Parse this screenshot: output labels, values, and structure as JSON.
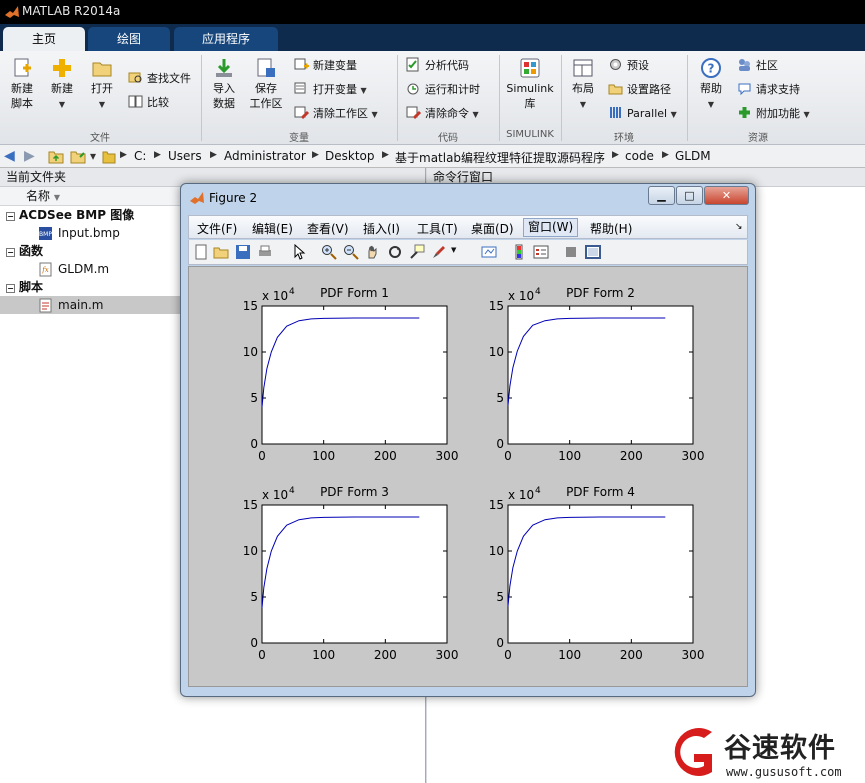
{
  "window": {
    "title": "MATLAB R2014a"
  },
  "tabs": [
    "主页",
    "绘图",
    "应用程序"
  ],
  "ribbon": {
    "file": {
      "new_script": "新建\n脚本",
      "new": "新建",
      "open": "打开",
      "find_files": "查找文件",
      "compare": "比较",
      "group": "文件"
    },
    "variable": {
      "import": "导入\n数据",
      "save_ws": "保存\n工作区",
      "new_var": "新建变量",
      "open_var": "打开变量",
      "clear_ws": "清除工作区",
      "group": "变量"
    },
    "code": {
      "analyze": "分析代码",
      "run_time": "运行和计时",
      "clear_cmd": "清除命令",
      "group": "代码"
    },
    "simulink": {
      "lib": "Simulink\n库",
      "group": "SIMULINK"
    },
    "env": {
      "layout": "布局",
      "prefs": "预设",
      "set_path": "设置路径",
      "parallel": "Parallel",
      "group": "环境"
    },
    "resources": {
      "help": "帮助",
      "community": "社区",
      "support": "请求支持",
      "addons": "附加功能",
      "group": "资源"
    }
  },
  "address": {
    "crumbs": [
      "C:",
      "Users",
      "Administrator",
      "Desktop",
      "基于matlab编程纹理特征提取源码程序",
      "code",
      "GLDM"
    ]
  },
  "left_panel": {
    "title": "当前文件夹",
    "column": "名称",
    "sections": [
      {
        "header": "ACDSee BMP 图像",
        "items": [
          "Input.bmp"
        ]
      },
      {
        "header": "函数",
        "items": [
          "GLDM.m"
        ]
      },
      {
        "header": "脚本",
        "items": [
          "main.m"
        ]
      }
    ]
  },
  "right_panel": {
    "title": "命令行窗口"
  },
  "figure": {
    "title": "Figure 2",
    "menus": [
      "文件(F)",
      "编辑(E)",
      "查看(V)",
      "插入(I)",
      "工具(T)",
      "桌面(D)",
      "窗口(W)",
      "帮助(H)"
    ],
    "active_menu": "窗口(W)"
  },
  "chart_data": [
    {
      "type": "line",
      "title": "PDF Form 1",
      "exponent_label": "x 10",
      "exponent": "4",
      "xlim": [
        0,
        300
      ],
      "ylim": [
        0,
        15
      ],
      "xticks": [
        "0",
        "100",
        "200",
        "300"
      ],
      "yticks": [
        "0",
        "5",
        "10",
        "15"
      ],
      "series": [
        {
          "x": [
            0,
            3,
            8,
            15,
            25,
            40,
            60,
            80,
            100,
            150,
            200,
            255
          ],
          "y": [
            4.0,
            6.1,
            8.2,
            10.0,
            11.6,
            12.8,
            13.4,
            13.6,
            13.65,
            13.7,
            13.7,
            13.7
          ]
        }
      ]
    },
    {
      "type": "line",
      "title": "PDF Form 2",
      "exponent_label": "x 10",
      "exponent": "4",
      "xlim": [
        0,
        300
      ],
      "ylim": [
        0,
        15
      ],
      "xticks": [
        "0",
        "100",
        "200",
        "300"
      ],
      "yticks": [
        "0",
        "5",
        "10",
        "15"
      ],
      "series": [
        {
          "x": [
            0,
            3,
            8,
            15,
            25,
            40,
            60,
            80,
            100,
            150,
            200,
            255
          ],
          "y": [
            4.2,
            6.3,
            8.3,
            10.1,
            11.7,
            12.9,
            13.4,
            13.6,
            13.65,
            13.7,
            13.7,
            13.7
          ]
        }
      ]
    },
    {
      "type": "line",
      "title": "PDF Form 3",
      "exponent_label": "x 10",
      "exponent": "4",
      "xlim": [
        0,
        300
      ],
      "ylim": [
        0,
        15
      ],
      "xticks": [
        "0",
        "100",
        "200",
        "300"
      ],
      "yticks": [
        "0",
        "5",
        "10",
        "15"
      ],
      "series": [
        {
          "x": [
            0,
            3,
            8,
            15,
            25,
            40,
            60,
            80,
            100,
            150,
            200,
            255
          ],
          "y": [
            3.8,
            6.0,
            8.1,
            10.0,
            11.6,
            12.8,
            13.4,
            13.6,
            13.65,
            13.7,
            13.7,
            13.7
          ]
        }
      ]
    },
    {
      "type": "line",
      "title": "PDF Form 4",
      "exponent_label": "x 10",
      "exponent": "4",
      "xlim": [
        0,
        300
      ],
      "ylim": [
        0,
        15
      ],
      "xticks": [
        "0",
        "100",
        "200",
        "300"
      ],
      "yticks": [
        "0",
        "5",
        "10",
        "15"
      ],
      "series": [
        {
          "x": [
            0,
            3,
            8,
            15,
            25,
            40,
            60,
            80,
            100,
            150,
            200,
            255
          ],
          "y": [
            4.0,
            6.2,
            8.2,
            10.0,
            11.6,
            12.8,
            13.4,
            13.6,
            13.65,
            13.7,
            13.7,
            13.7
          ]
        }
      ]
    }
  ],
  "watermark": {
    "text": "谷速软件",
    "url": "www.gususoft.com"
  },
  "colors": {
    "accent_dark": "#0e2a4d",
    "line": "#0000b4",
    "watermark_red": "#d71c1c"
  }
}
